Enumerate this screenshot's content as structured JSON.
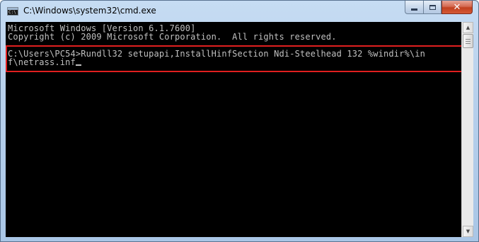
{
  "window": {
    "title": "C:\\Windows\\system32\\cmd.exe",
    "app_icon": "cmd-icon",
    "app_icon_glyph": "C:\\"
  },
  "caption_buttons": {
    "minimize_icon": "minimize-icon",
    "maximize_icon": "maximize-icon",
    "close_icon": "close-icon",
    "close_glyph": "✕"
  },
  "console": {
    "lines": [
      "Microsoft Windows [Version 6.1.7600]",
      "Copyright (c) 2009 Microsoft Corporation.  All rights reserved.",
      "",
      "C:\\Users\\PC54>Rundll32 setupapi,InstallHinfSection Ndi-Steelhead 132 %windir%\\in",
      "f\\netrass.inf"
    ],
    "text_color": "#c0c0c0",
    "background_color": "#000000"
  },
  "annotation": {
    "highlight_color": "#e01f1f"
  },
  "scrollbar": {
    "up_arrow": "▲",
    "down_arrow": "▼"
  }
}
